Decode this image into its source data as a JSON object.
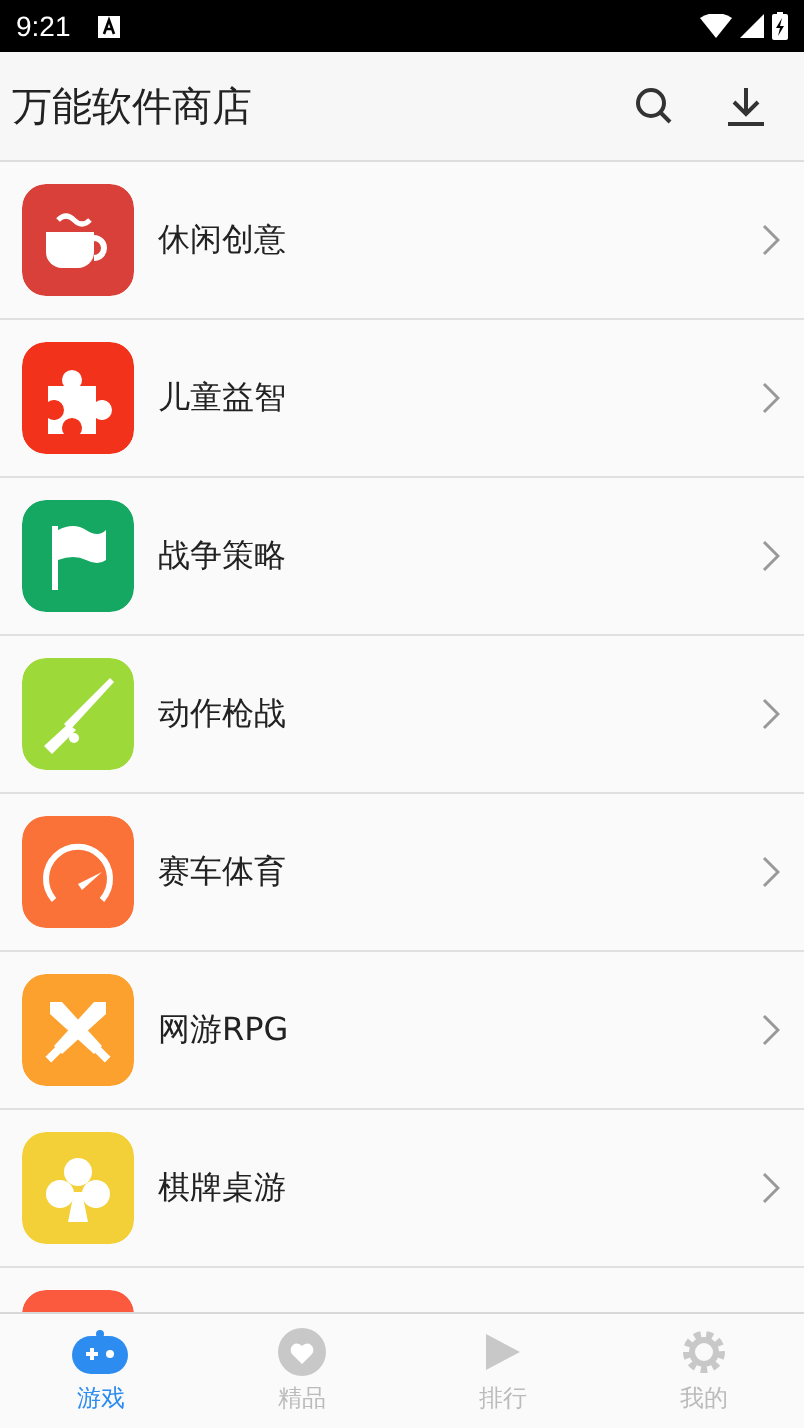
{
  "status_bar": {
    "time": "9:21"
  },
  "app_bar": {
    "title": "万能软件商店"
  },
  "categories": [
    {
      "label": "休闲创意",
      "color": "#d9403a"
    },
    {
      "label": "儿童益智",
      "color": "#f2321a"
    },
    {
      "label": "战争策略",
      "color": "#15a863"
    },
    {
      "label": "动作枪战",
      "color": "#9ed93a"
    },
    {
      "label": "赛车体育",
      "color": "#fb7238"
    },
    {
      "label": "网游RPG",
      "color": "#fca12e"
    },
    {
      "label": "棋牌桌游",
      "color": "#f3cf38"
    },
    {
      "color": "#fb5a3e"
    }
  ],
  "bottom_nav": [
    {
      "label": "游戏",
      "selected": true
    },
    {
      "label": "精品",
      "selected": false
    },
    {
      "label": "排行",
      "selected": false
    },
    {
      "label": "我的",
      "selected": false
    }
  ]
}
